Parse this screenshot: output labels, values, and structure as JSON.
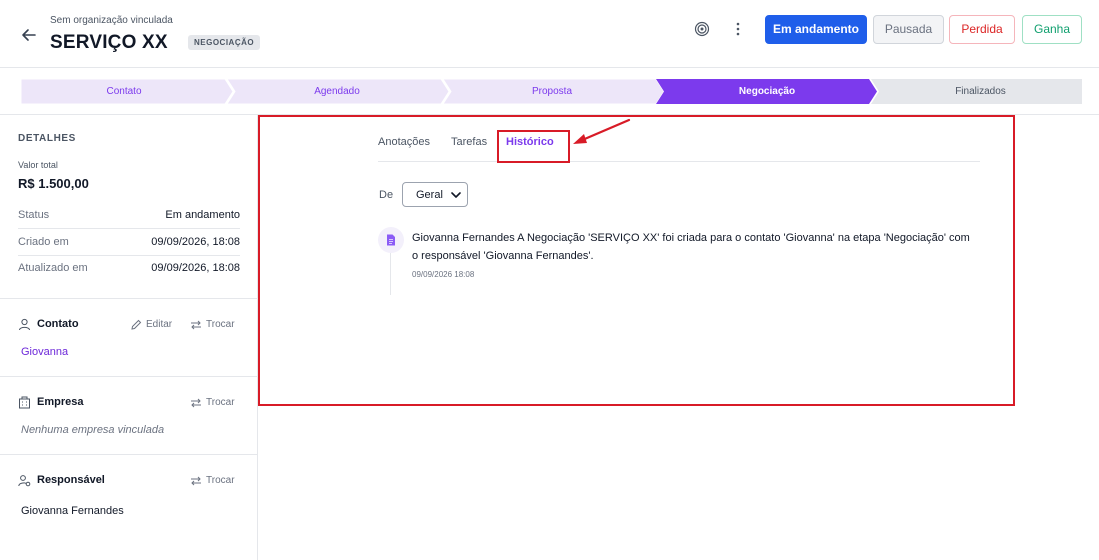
{
  "header": {
    "org_label": "Sem organização vinculada",
    "deal_title": "SERVIÇO XX",
    "stage_badge": "NEGOCIAÇÃO",
    "status_buttons": {
      "andamento": "Em andamento",
      "pausada": "Pausada",
      "perdida": "Perdida",
      "ganha": "Ganha"
    },
    "icons": [
      "back-arrow-icon",
      "target-icon",
      "more-vertical-icon"
    ]
  },
  "pipeline": {
    "stages": [
      "Contato",
      "Agendado",
      "Proposta",
      "Negociação",
      "Finalizados"
    ],
    "active_index": 3,
    "colors": {
      "done": "#ede6f9",
      "active": "#7c3aed",
      "todo": "#e5e7eb"
    }
  },
  "sidebar": {
    "details_title": "DETALHES",
    "valor_label": "Valor total",
    "valor_value": "R$ 1.500,00",
    "rows": [
      {
        "label": "Status",
        "value": "Em andamento"
      },
      {
        "label": "Criado em",
        "value": "09/09/2026, 18:08"
      },
      {
        "label": "Atualizado em",
        "value": "09/09/2026, 18:08"
      }
    ],
    "contato": {
      "title": "Contato",
      "edit_label": "Editar",
      "swap_label": "Trocar",
      "name": "Giovanna"
    },
    "empresa": {
      "title": "Empresa",
      "swap_label": "Trocar",
      "empty": "Nenhuma empresa vinculada"
    },
    "responsavel": {
      "title": "Responsável",
      "swap_label": "Trocar",
      "name": "Giovanna Fernandes"
    }
  },
  "main": {
    "tabs": [
      "Anotações",
      "Tarefas",
      "Histórico"
    ],
    "active_tab": "Histórico",
    "filter_label": "De",
    "filter_value": "Geral",
    "history": [
      {
        "text": "Giovanna Fernandes A Negociação 'SERVIÇO XX' foi criada para o contato 'Giovanna' na etapa 'Negociação' com o responsável 'Giovanna Fernandes'.",
        "time": "09/09/2026 18:08"
      }
    ]
  },
  "colors": {
    "accent": "#7c3aed",
    "primary": "#1f5eea",
    "annotation_red": "#d81b27"
  }
}
